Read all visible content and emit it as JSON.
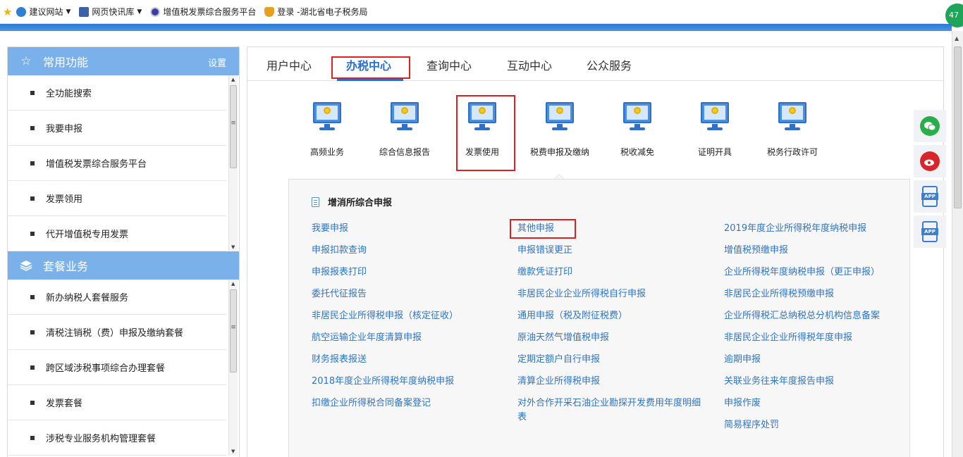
{
  "favorites_bar": {
    "items": [
      {
        "label": "建议网站",
        "icon": "ie-icon",
        "dropdown": true
      },
      {
        "label": "网页快讯库",
        "icon": "page-icon",
        "dropdown": true
      },
      {
        "label": "增值税发票综合服务平台",
        "icon": "globe-icon",
        "dropdown": false
      },
      {
        "label": "登录 -湖北省电子税务局",
        "icon": "shield-icon",
        "dropdown": false
      }
    ],
    "badge": "47"
  },
  "left_panel": {
    "common": {
      "title": "常用功能",
      "setting": "设置",
      "items": [
        "全功能搜索",
        "我要申报",
        "增值税发票综合服务平台",
        "发票领用",
        "代开增值税专用发票"
      ]
    },
    "package": {
      "title": "套餐业务",
      "items": [
        "新办纳税人套餐服务",
        "清税注销税（费）申报及缴纳套餐",
        "跨区域涉税事项综合办理套餐",
        "发票套餐",
        "涉税专业服务机构管理套餐"
      ]
    }
  },
  "tabs": [
    "用户中心",
    "办税中心",
    "查询中心",
    "互动中心",
    "公众服务"
  ],
  "active_tab": "办税中心",
  "icon_buttons": [
    "高频业务",
    "综合信息报告",
    "发票使用",
    "税费申报及缴纳",
    "税收减免",
    "证明开具",
    "税务行政许可"
  ],
  "subpanel": {
    "title": "增消所综合申报",
    "col1": [
      "我要申报",
      "申报扣款查询",
      "申报报表打印",
      "委托代征报告",
      "非居民企业所得税申报（核定征收）",
      "航空运输企业年度清算申报",
      "财务报表报送",
      "2018年度企业所得税年度纳税申报",
      "扣缴企业所得税合同备案登记"
    ],
    "col2": [
      "其他申报",
      "申报错误更正",
      "缴款凭证打印",
      "非居民企业企业所得税自行申报",
      "通用申报（税及附征税费）",
      "原油天然气增值税申报",
      "定期定额户自行申报",
      "清算企业所得税申报",
      "对外合作开采石油企业勘探开发费用年度明细表"
    ],
    "col3": [
      "2019年度企业所得税年度纳税申报",
      "增值税预缴申报",
      "企业所得税年度纳税申报（更正申报）",
      "非居民企业所得税预缴申报",
      "企业所得税汇总纳税总分机构信息备案",
      "非居民企业企业所得税年度申报",
      "逾期申报",
      "关联业务往来年度报告申报",
      "申报作废",
      "简易程序处罚"
    ]
  },
  "float_bar": {
    "items": [
      {
        "icon": "wechat-icon",
        "text": ""
      },
      {
        "icon": "weibo-icon",
        "text": ""
      },
      {
        "icon": "app-icon",
        "text": "APP"
      },
      {
        "icon": "app-icon",
        "text": "APP"
      }
    ]
  },
  "colors": {
    "accent": "#2a6fcf",
    "section_header": "#7bb1ea",
    "link": "#2e74c8",
    "highlight": "#e02020"
  }
}
